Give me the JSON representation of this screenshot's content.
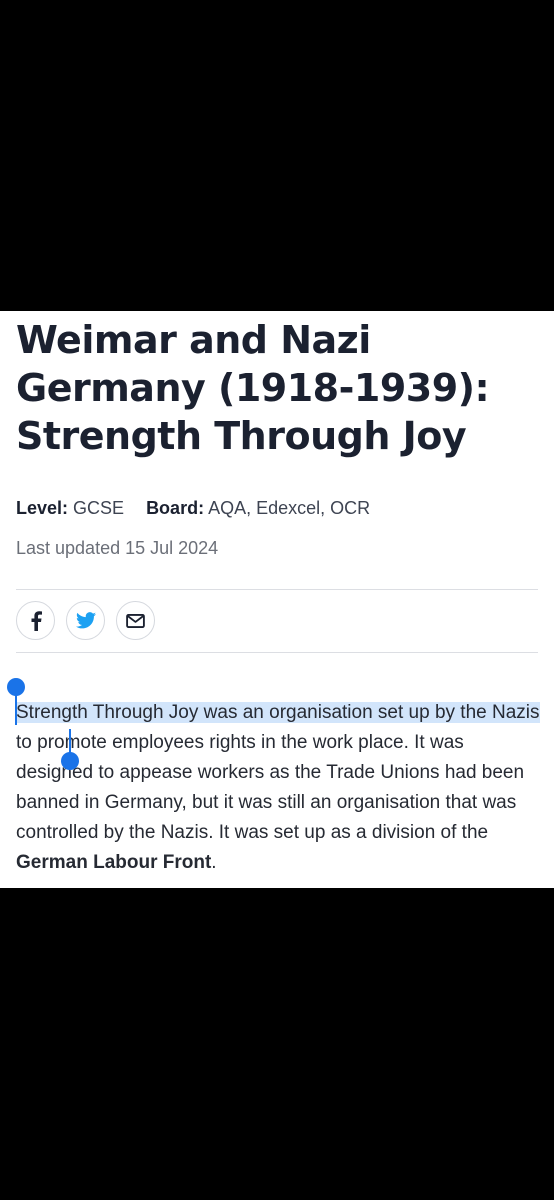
{
  "article": {
    "title": "Weimar and Nazi Germany (1918-1939): Strength Through Joy",
    "level_label": "Level:",
    "level_value": "GCSE",
    "board_label": "Board:",
    "board_value": "AQA, Edexcel, OCR",
    "last_updated": "Last updated 15 Jul 2024",
    "body": {
      "selected": "Strength Through Joy was an organisation set up by the Nazis",
      "text": " to promote employees rights in the work place. It was designed to appease workers as the Trade Unions had been banned in Germany, but it was still an organisation that was controlled by the Nazis. It was set up as a division of the ",
      "bold": "German Labour Front",
      "end": "."
    }
  },
  "share": {
    "icons": [
      "facebook-icon",
      "twitter-icon",
      "email-icon"
    ],
    "colors": {
      "facebook": "#1b2130",
      "twitter": "#1da1f2",
      "email": "#1b2130"
    }
  },
  "selection": {
    "color": "#1a73e8",
    "highlight": "#d2e5fb"
  }
}
